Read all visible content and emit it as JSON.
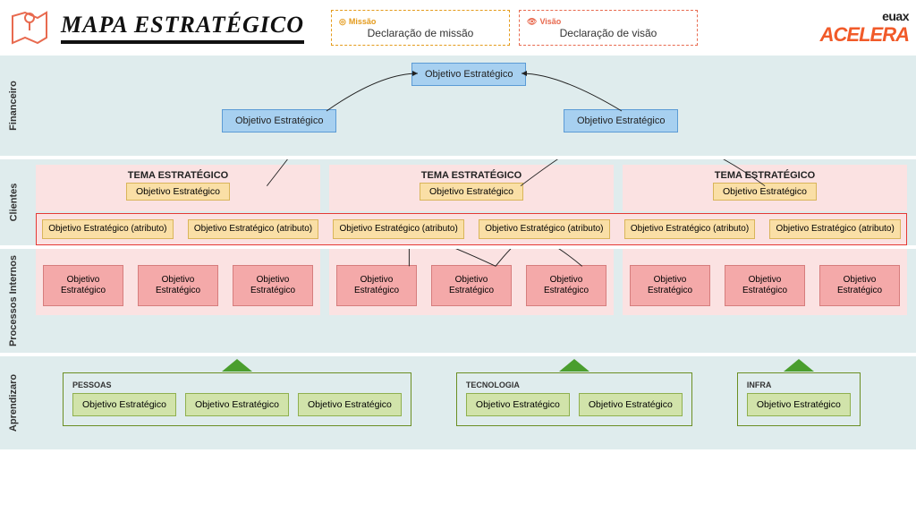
{
  "header": {
    "title": "MAPA ESTRATÉGICO",
    "mission_label": "Missão",
    "mission_text": "Declaração de missão",
    "vision_label": "Visão",
    "vision_text": "Declaração de visão",
    "brand_top": "euax",
    "brand_bottom": "ACELERA"
  },
  "perspectives": {
    "financeiro": "Financeiro",
    "clientes": "Clientes",
    "processos": "Processos Internos",
    "aprendizado": "Aprendizaro"
  },
  "financeiro_objectives": {
    "top": "Objetivo Estratégico",
    "left": "Objetivo Estratégico",
    "right": "Objetivo Estratégico"
  },
  "themes": [
    {
      "title": "TEMA ESTRATÉGICO",
      "objective": "Objetivo Estratégico"
    },
    {
      "title": "TEMA ESTRATÉGICO",
      "objective": "Objetivo Estratégico"
    },
    {
      "title": "TEMA ESTRATÉGICO",
      "objective": "Objetivo Estratégico"
    }
  ],
  "attributes": [
    "Objetivo Estratégico (atributo)",
    "Objetivo Estratégico (atributo)",
    "Objetivo Estratégico (atributo)",
    "Objetivo Estratégico (atributo)",
    "Objetivo Estratégico (atributo)",
    "Objetivo Estratégico (atributo)"
  ],
  "processes": {
    "group1": [
      "Objetivo Estratégico",
      "Objetivo Estratégico",
      "Objetivo Estratégico"
    ],
    "group2": [
      "Objetivo Estratégico",
      "Objetivo Estratégico",
      "Objetivo Estratégico"
    ],
    "group3": [
      "Objetivo Estratégico",
      "Objetivo Estratégico",
      "Objetivo Estratégico"
    ]
  },
  "learning": {
    "pessoas": {
      "label": "PESSOAS",
      "items": [
        "Objetivo Estratégico",
        "Objetivo Estratégico",
        "Objetivo Estratégico"
      ]
    },
    "tecnologia": {
      "label": "TECNOLOGIA",
      "items": [
        "Objetivo Estratégico",
        "Objetivo Estratégico"
      ]
    },
    "infra": {
      "label": "INFRA",
      "items": [
        "Objetivo Estratégico"
      ]
    }
  }
}
